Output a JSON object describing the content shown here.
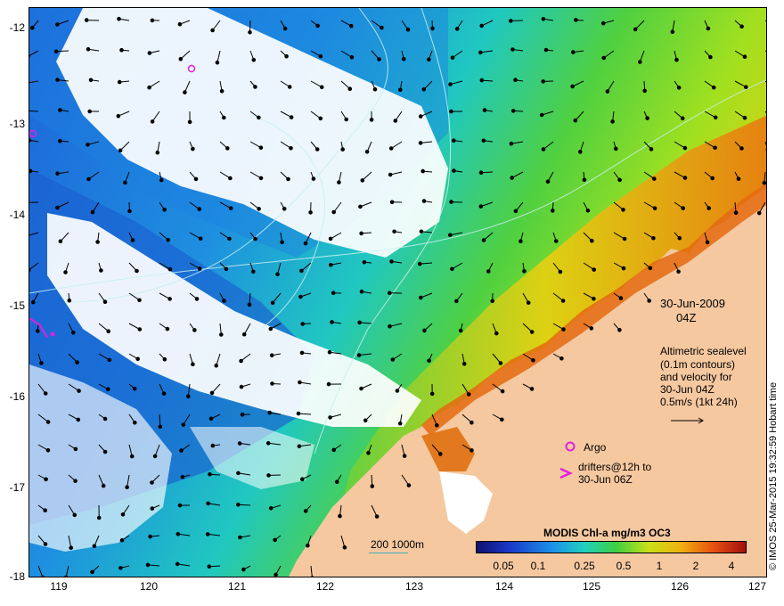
{
  "map": {
    "date": "30-Jun-2009",
    "time": "04Z",
    "legend_lines": [
      "Altimetric sealevel",
      "(0.1m contours)",
      "and velocity for",
      "30-Jun 04Z",
      "0.5m/s (1kt 24h)"
    ],
    "argo_label": "Argo",
    "drifters_lines": [
      "drifters@12h to",
      "30-Jun 06Z"
    ],
    "colorbar_title": "MODIS Chl-a mg/m3 OC3",
    "colorbar_ticks": [
      "0.05",
      "0.1",
      "0.25",
      "0.5",
      "1",
      "2",
      "4"
    ],
    "scale_label": "200  1000m",
    "credit": "© IMOS 25-Mar-2015 19:32:59 Hobart time",
    "lat_labels": [
      "-12",
      "-13",
      "-14",
      "-15",
      "-16",
      "-17",
      "-18"
    ],
    "lon_labels": [
      "119",
      "120",
      "121",
      "122",
      "123",
      "124",
      "125",
      "126",
      "127"
    ],
    "colors": {
      "land": "#f5c8a0",
      "cloud": "#ffffff",
      "argo_marker": "#e020e0",
      "contour": "#c8f0f0"
    }
  }
}
